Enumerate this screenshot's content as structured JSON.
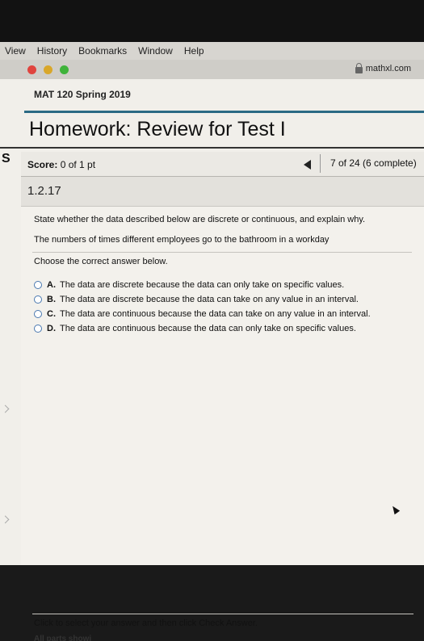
{
  "menubar": {
    "items": [
      "View",
      "History",
      "Bookmarks",
      "Window",
      "Help"
    ]
  },
  "browser": {
    "url": "mathxl.com"
  },
  "course": {
    "title": "MAT 120 Spring 2019"
  },
  "homework": {
    "title": "Homework: Review for Test I"
  },
  "sidebar_letter": "S",
  "score": {
    "label": "Score:",
    "value": "0 of 1 pt"
  },
  "progress": {
    "text": "7 of 24 (6 complete)"
  },
  "question": {
    "number": "1.2.17",
    "prompt": "State whether the data described below are discrete or continuous, and explain why.",
    "statement": "The numbers of times different employees go to the bathroom in a workday",
    "instruction": "Choose the correct answer below.",
    "options": [
      {
        "letter": "A.",
        "text": "The data are discrete because the data can only take on specific values."
      },
      {
        "letter": "B.",
        "text": "The data are discrete because the data can take on any value in an interval."
      },
      {
        "letter": "C.",
        "text": "The data are continuous because the data can take on any value in an interval."
      },
      {
        "letter": "D.",
        "text": "The data are continuous because the data can only take on specific values."
      }
    ]
  },
  "footer": {
    "instruction": "Click to select your answer and then click Check Answer.",
    "partial": "All parts showi"
  },
  "colors": {
    "accent_rule": "#2b6a84",
    "radio_border": "#4a79b0"
  }
}
